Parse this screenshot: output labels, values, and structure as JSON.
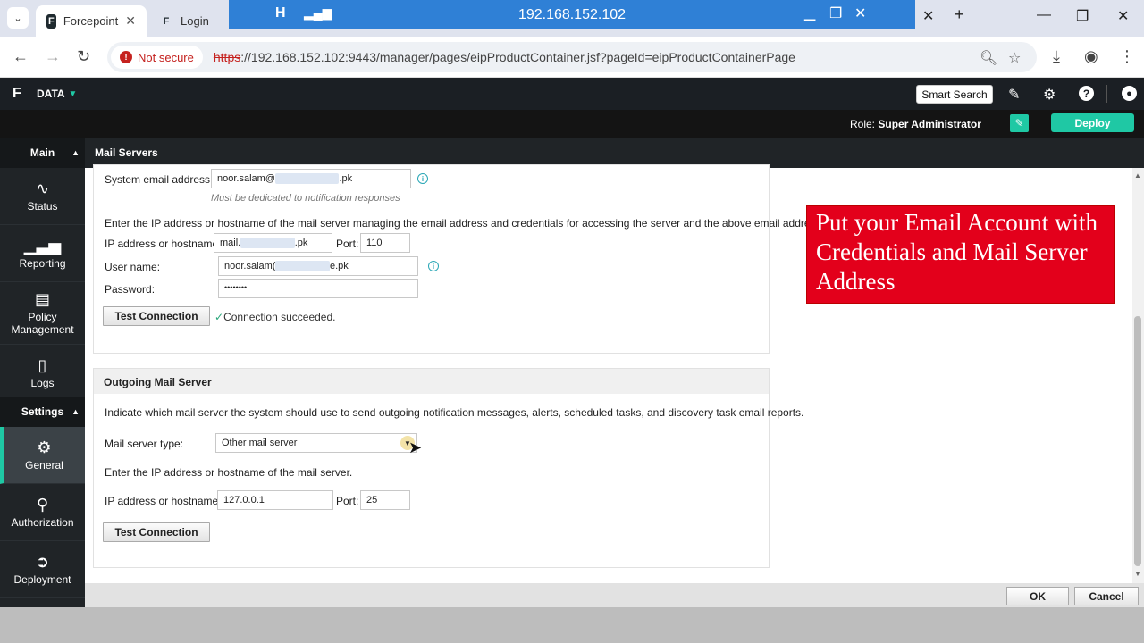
{
  "browser": {
    "tabs": [
      {
        "label": "Forcepoint",
        "favicon": "F"
      },
      {
        "label": "Login",
        "favicon": "F"
      }
    ],
    "rdp_title": "192.168.152.102",
    "not_secure": "Not secure",
    "url_proto": "https",
    "url_rest": "://192.168.152.102:9443/manager/pages/eipProductContainer.jsf?pageId=eipProductContainerPage"
  },
  "app": {
    "logo": "F",
    "module": "DATA",
    "smart_search": "Smart Search",
    "role_label": "Role:",
    "role_value": "Super Administrator",
    "deploy": "Deploy"
  },
  "sidebar": {
    "main_header": "Main",
    "settings_header": "Settings",
    "items": [
      {
        "label": "Status",
        "icon": "pulse-icon"
      },
      {
        "label": "Reporting",
        "icon": "bar-chart-icon"
      },
      {
        "label": "Policy Management",
        "icon": "document-icon"
      },
      {
        "label": "Logs",
        "icon": "clipboard-icon"
      },
      {
        "label": "General",
        "icon": "gear-icon"
      },
      {
        "label": "Authorization",
        "icon": "user-check-icon"
      },
      {
        "label": "Deployment",
        "icon": "arrow-circle-icon"
      }
    ]
  },
  "page": {
    "title": "Mail Servers",
    "incoming": {
      "email_label": "System email address:",
      "email_prefix": "noor.salam@",
      "email_suffix": ".pk",
      "email_hint": "Must be dedicated to notification responses",
      "instructions": "Enter the IP address or hostname of the mail server managing the email address and credentials for accessing the server and the above email address.",
      "host_label": "IP address or hostname:",
      "host_prefix": "mail.",
      "host_suffix": ".pk",
      "port_label": "Port:",
      "port_value": "110",
      "user_label": "User name:",
      "user_prefix": "noor.salam(",
      "user_suffix": "e.pk",
      "password_label": "Password:",
      "password_value": "••••••••",
      "test_button": "Test Connection",
      "test_result": "Connection succeeded."
    },
    "outgoing": {
      "header": "Outgoing Mail Server",
      "instructions": "Indicate which mail server the system should use to send outgoing notification messages, alerts, scheduled tasks, and discovery task email reports.",
      "type_label": "Mail server type:",
      "type_value": "Other mail server",
      "hint": "Enter the IP address or hostname of the mail server.",
      "host_label": "IP address or hostname:",
      "host_value": "127.0.0.1",
      "port_label": "Port:",
      "port_value": "25",
      "test_button": "Test Connection"
    },
    "overlay_note": "Put your Email Account with Credentials and Mail Server Address"
  },
  "footer": {
    "ok": "OK",
    "cancel": "Cancel"
  },
  "colors": {
    "accent": "#1fc8a4",
    "note_red": "#e3001b",
    "rdp_blue": "#2f80d6"
  }
}
